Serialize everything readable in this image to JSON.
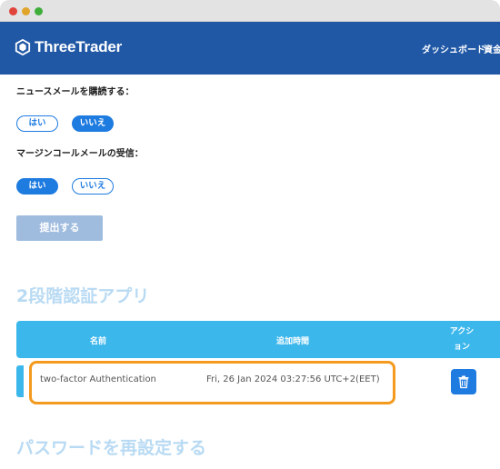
{
  "brand": {
    "name": "ThreeTrader",
    "colors": {
      "header": "#2058a6",
      "accent": "#1e7be0",
      "table_header": "#3cb7ec",
      "highlight": "#f39a1f"
    }
  },
  "nav": {
    "dashboard": "ダッシュボード",
    "funds": "資金"
  },
  "newsletter": {
    "label": "ニュースメールを購読する：",
    "yes": "はい",
    "no": "いいえ",
    "selected": "いいえ"
  },
  "margin_call": {
    "label": "マージンコールメールの受信：",
    "yes": "はい",
    "no": "いいえ",
    "selected": "はい"
  },
  "submit_label": "提出する",
  "two_factor": {
    "title": "2段階認証アプリ",
    "columns": [
      "名前",
      "追加時間",
      "アクション"
    ],
    "rows": [
      {
        "name": "two-factor Authentication",
        "added": "Fri, 26 Jan 2024 03:27:56 UTC+2(EET)",
        "action_icon": "trash-icon"
      }
    ]
  },
  "password_reset": {
    "title": "パスワードを再設定する"
  },
  "window_controls": [
    "close",
    "minimize",
    "zoom"
  ]
}
